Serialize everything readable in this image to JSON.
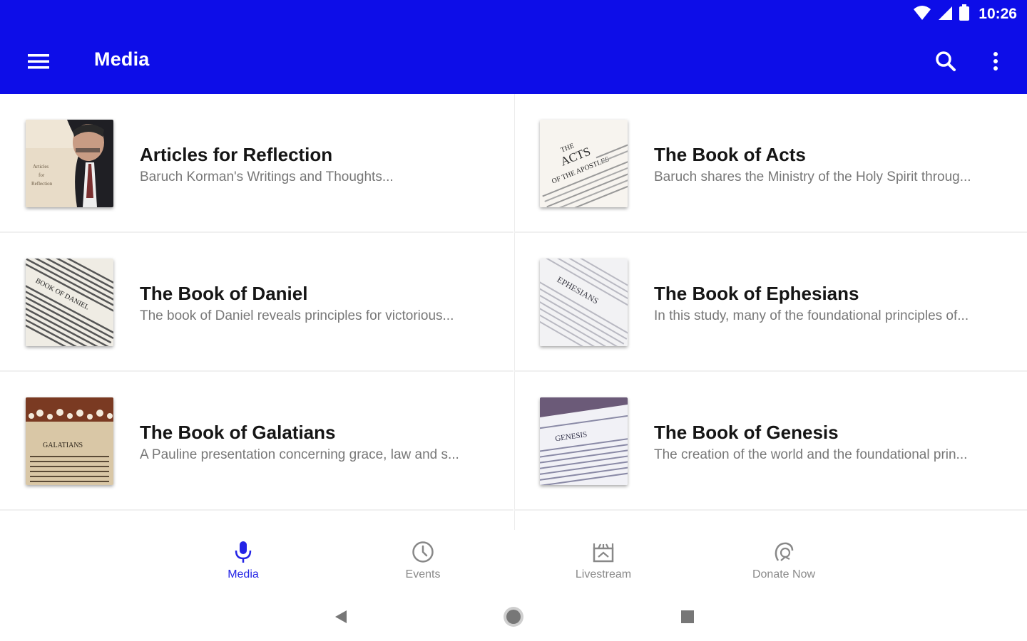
{
  "status": {
    "time": "10:26"
  },
  "toolbar": {
    "title": "Media",
    "menu_icon": "menu-icon",
    "search_icon": "search-icon",
    "more_icon": "more-vert-icon"
  },
  "colors": {
    "primary": "#0d0de8",
    "accent": "#2424e6",
    "text_primary": "#151515",
    "text_secondary": "#777777"
  },
  "items": [
    {
      "title": "Articles for Reflection",
      "subtitle": "Baruch Korman's Writings and Thoughts..."
    },
    {
      "title": "The Book of Acts",
      "subtitle": "Baruch shares the Ministry of the Holy Spirit throug..."
    },
    {
      "title": "The Book of Daniel",
      "subtitle": "The book of Daniel reveals principles for victorious..."
    },
    {
      "title": "The Book of Ephesians",
      "subtitle": "In this study, many of the foundational principles of..."
    },
    {
      "title": "The Book of Galatians",
      "subtitle": "A Pauline presentation concerning grace, law and s..."
    },
    {
      "title": "The Book of Genesis",
      "subtitle": "The creation of the world and the foundational prin..."
    }
  ],
  "thumbs": {
    "t0": {
      "line1": "Articles",
      "line2": "for",
      "line3": "Reflection"
    },
    "t1": {
      "line1": "THE",
      "line2": "ACTS",
      "line3": "OF THE APOSTLES"
    },
    "t2": {
      "line1": "BOOK OF DANIEL"
    },
    "t3": {
      "line1": "EPHESIANS"
    },
    "t4": {
      "line1": "GALATIANS"
    },
    "t5": {
      "line1": "GENESIS"
    }
  },
  "bottom_nav": [
    {
      "label": "Media",
      "icon": "mic-icon",
      "active": true
    },
    {
      "label": "Events",
      "icon": "clock-icon",
      "active": false
    },
    {
      "label": "Livestream",
      "icon": "livestream-icon",
      "active": false
    },
    {
      "label": "Donate Now",
      "icon": "donate-icon",
      "active": false
    }
  ],
  "system_nav": {
    "back": "back-icon",
    "home": "home-icon",
    "recents": "recents-icon"
  }
}
